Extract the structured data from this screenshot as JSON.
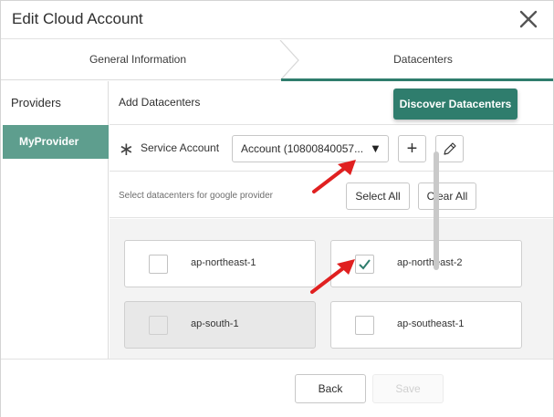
{
  "dialog": {
    "title": "Edit Cloud Account",
    "close_icon": "close-icon"
  },
  "steps": [
    {
      "label": "General Information",
      "active": false
    },
    {
      "label": "Datacenters",
      "active": true
    }
  ],
  "sidebar": {
    "title": "Providers",
    "items": [
      {
        "label": "MyProvider",
        "selected": true
      }
    ]
  },
  "main": {
    "title": "Add Datacenters",
    "discover_button": "Discover Datacenters",
    "service_account": {
      "required_marker": "∗",
      "label": "Service Account",
      "value": "Account (10800840057...",
      "caret": "▼",
      "add_icon": "plus-icon",
      "edit_icon": "pencil-icon"
    },
    "select_hint": "Select datacenters for google provider",
    "select_all": "Select All",
    "clear_all": "Clear All",
    "datacenters": [
      {
        "name": "ap-northeast-1",
        "checked": false,
        "disabled": false
      },
      {
        "name": "ap-northeast-2",
        "checked": true,
        "disabled": false
      },
      {
        "name": "ap-south-1",
        "checked": false,
        "disabled": true
      },
      {
        "name": "ap-southeast-1",
        "checked": false,
        "disabled": false
      }
    ]
  },
  "footer": {
    "back": "Back",
    "save": "Save"
  },
  "colors": {
    "accent": "#2f7d6d",
    "sidebar_selected": "#5e9e8e",
    "annotation_arrow": "#e02020"
  }
}
